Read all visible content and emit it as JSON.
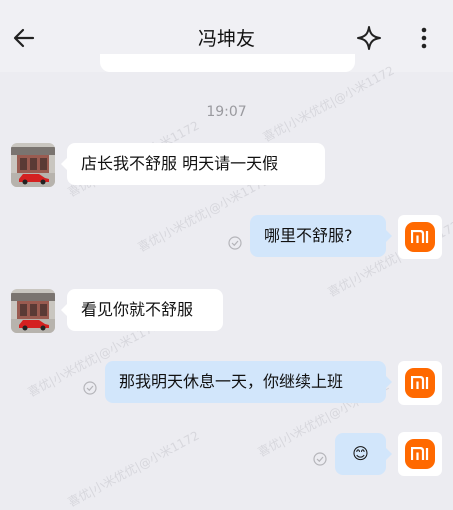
{
  "header": {
    "title": "冯坤友",
    "back_icon": "arrow-left-icon",
    "sparkle_icon": "sparkle-icon",
    "more_icon": "more-vertical-icon"
  },
  "timestamp": "19:07",
  "messages": [
    {
      "direction": "in",
      "text": "店长我不舒服  明天请一天假"
    },
    {
      "direction": "out",
      "text": "哪里不舒服?",
      "read": true
    },
    {
      "direction": "in",
      "text": "看见你就不舒服"
    },
    {
      "direction": "out",
      "text": "那我明天休息一天，你继续上班",
      "read": true
    },
    {
      "direction": "out",
      "text": "😊",
      "read": true
    }
  ],
  "watermark_text": "喜优|小米优优|@小米1172",
  "colors": {
    "background": "#ececf1",
    "incoming_bubble": "#ffffff",
    "outgoing_bubble": "#d2e6fb",
    "mi_orange": "#ff6900"
  }
}
